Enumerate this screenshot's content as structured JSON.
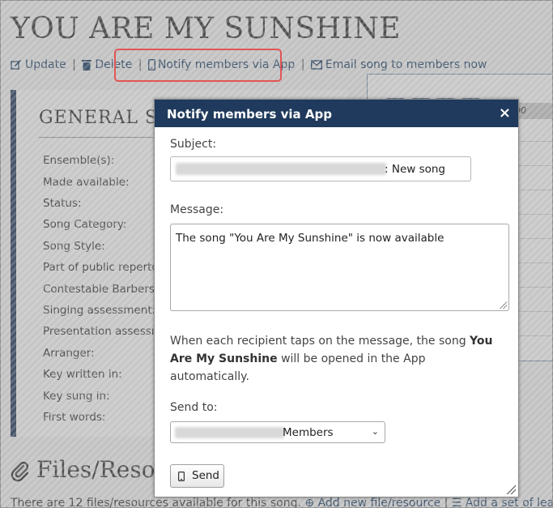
{
  "page": {
    "title": "YOU ARE MY SUNSHINE",
    "actions": {
      "update": "Update",
      "delete": "Delete",
      "notify": "Notify members via App",
      "email": "Email song to members now",
      "separator": "|"
    },
    "general": {
      "heading": "GENERAL SO",
      "labels": [
        "Ensemble(s):",
        "Made available:",
        "Status:",
        "Song Category:",
        "Song Style:",
        "Part of public repertoir",
        "Contestable Barbersho",
        "Singing assessment:",
        "Presentation assessme",
        "Arranger:",
        "Key written in:",
        "Key sung in:",
        "First words:"
      ]
    },
    "right_panel": {
      "header_fragment": "00"
    },
    "files": {
      "heading": "Files/Reso",
      "footer_text": "There are 12 files/resources available for this song.",
      "add_resource": "Add new file/resource",
      "add_learning": "Add a set of learning tra"
    }
  },
  "dialog": {
    "title": "Notify members via App",
    "close": "×",
    "subject_label": "Subject:",
    "subject_suffix": ": New song",
    "message_label": "Message:",
    "message_value": "The song \"You Are My Sunshine\" is now available",
    "info_prefix": "When each recipient taps on the message, the song ",
    "info_song": "You Are My Sunshine",
    "info_suffix": " will be opened in the App automatically.",
    "send_to_label": "Send to:",
    "send_to_value": "Members",
    "send_button": "Send"
  },
  "colors": {
    "dialog_header": "#1f3a5c",
    "link": "#1a3f66",
    "highlight": "#e25555"
  },
  "icons": {
    "update": "edit-icon",
    "delete": "trash-icon",
    "notify": "mobile-icon",
    "email": "envelope-icon",
    "files": "paperclip-icon",
    "send": "mobile-icon"
  }
}
